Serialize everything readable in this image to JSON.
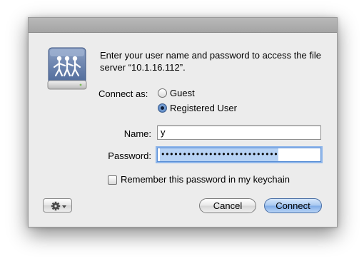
{
  "dialog": {
    "message": "Enter your user name and password to access the file server “10.1.16.112”.",
    "connect_as_label": "Connect as:",
    "options": [
      {
        "label": "Guest",
        "selected": false
      },
      {
        "label": "Registered User",
        "selected": true
      }
    ],
    "name_label": "Name:",
    "name_value": "y",
    "password_label": "Password:",
    "password_mask": "•••••••••••••••••••••••••••",
    "remember_label": "Remember this password in my keychain",
    "remember_checked": false,
    "cancel_label": "Cancel",
    "connect_label": "Connect",
    "icons": {
      "server": "file-server-icon",
      "action": "gear-icon"
    },
    "colors": {
      "accent": "#7fabe6",
      "selection": "#b7d2f4"
    }
  }
}
